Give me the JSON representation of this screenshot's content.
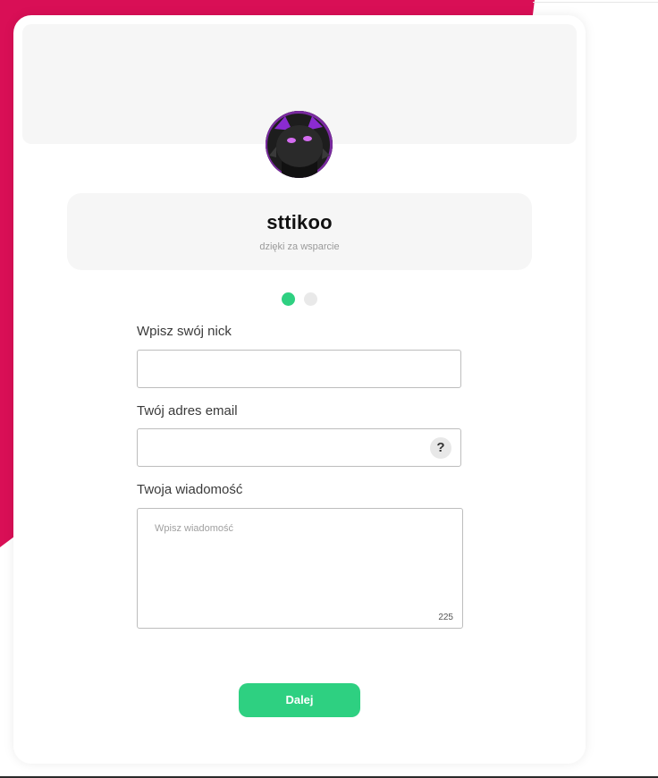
{
  "profile": {
    "name": "sttikoo",
    "subtitle": "dzięki za wsparcie",
    "avatar_icon": "dark-character-avatar"
  },
  "steps": {
    "current": 1,
    "total": 2
  },
  "form": {
    "nick_label": "Wpisz swój nick",
    "nick_value": "",
    "email_label": "Twój adres email",
    "email_value": "",
    "help_symbol": "?",
    "message_label": "Twoja wiadomość",
    "message_placeholder": "Wpisz wiadomość",
    "message_counter": "225",
    "next_label": "Dalej"
  },
  "colors": {
    "accent_pink": "#d90f56",
    "accent_green": "#2ed081",
    "panel_gray": "#f6f6f6"
  }
}
